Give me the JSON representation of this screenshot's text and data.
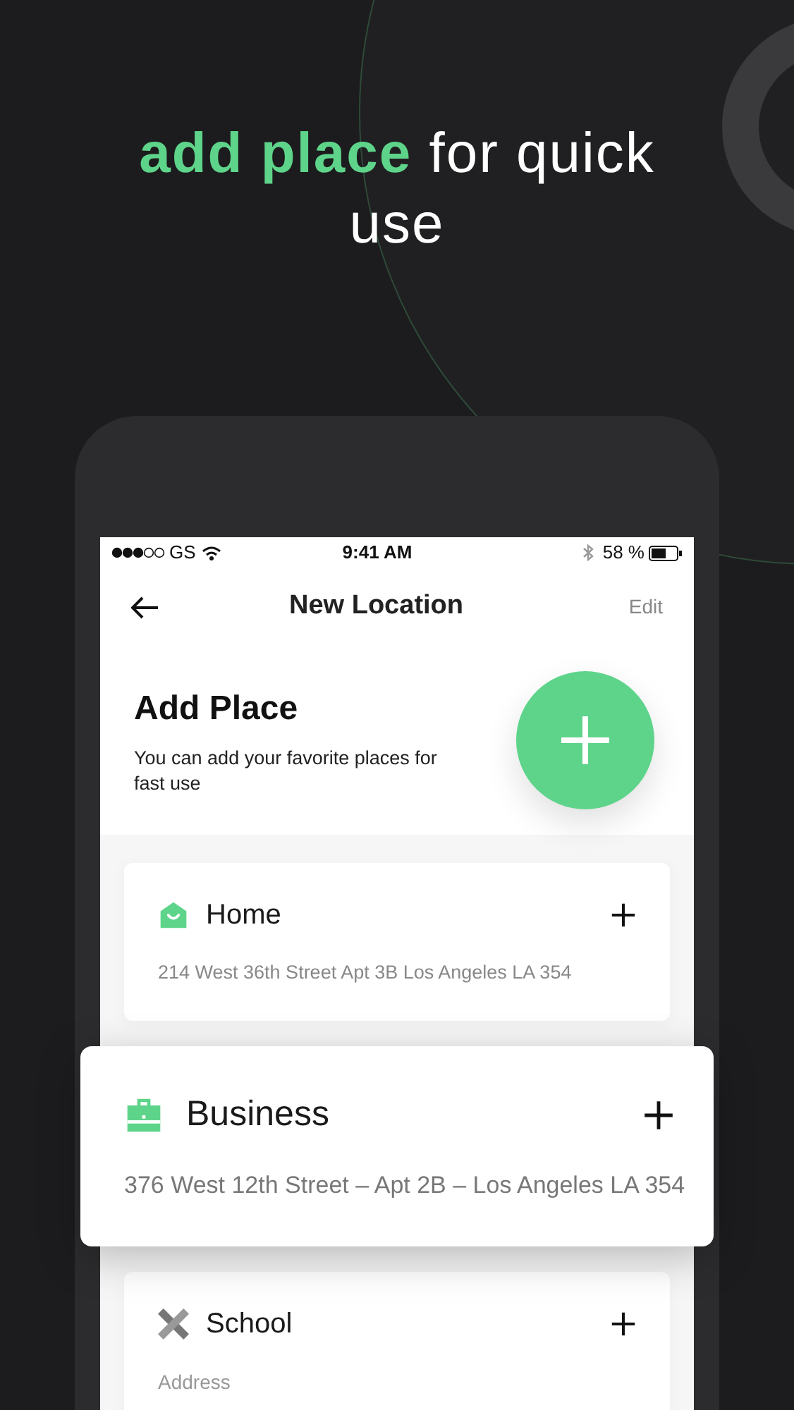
{
  "headline": {
    "highlight": "add place",
    "rest": "for quick use"
  },
  "status_bar": {
    "carrier": "GS",
    "time": "9:41 AM",
    "battery": "58 %"
  },
  "nav": {
    "title": "New Location",
    "action": "Edit"
  },
  "intro": {
    "title": "Add Place",
    "subtitle": "You can add your favorite places for fast use"
  },
  "places": [
    {
      "kind": "home",
      "name": "Home",
      "address": "214 West 36th Street  Apt 3B  Los Angeles LA 354",
      "raised": false
    },
    {
      "kind": "business",
      "name": "Business",
      "address": "376 West 12th Street – Apt 2B – Los Angeles LA 354",
      "raised": true
    },
    {
      "kind": "school",
      "name": "School",
      "placeholder": "Address",
      "raised": false
    }
  ]
}
